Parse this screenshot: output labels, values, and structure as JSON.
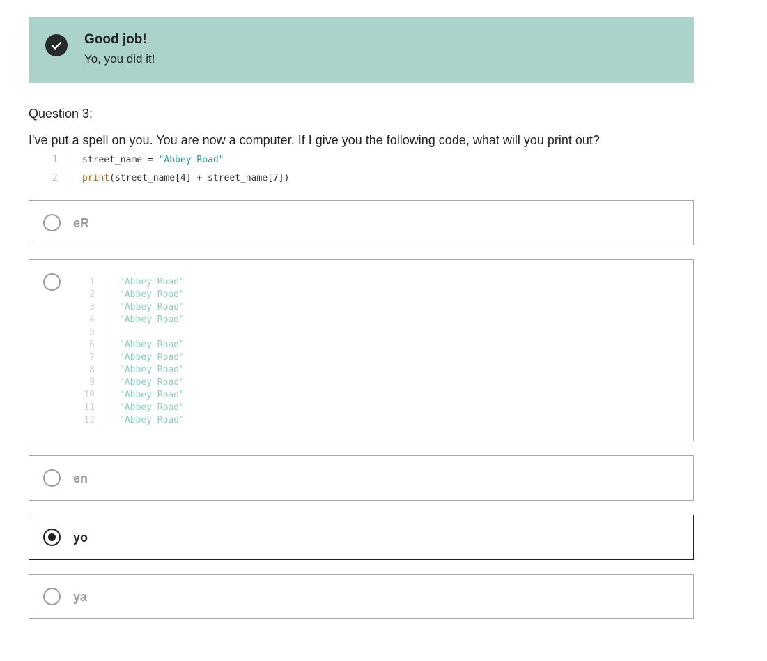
{
  "banner": {
    "title": "Good job!",
    "message": "Yo, you did it!",
    "icon": "check-icon",
    "bg_color": "#acd3cb"
  },
  "question": {
    "number_label": "Question 3:",
    "text": "I've put a spell on you. You are now a computer. If I give you the following code, what will you print out?",
    "code": {
      "lines": [
        {
          "num": "1",
          "var": "street_name",
          "op": " = ",
          "str": "\"Abbey Road\""
        },
        {
          "num": "2",
          "fn": "print",
          "rest": "(street_name[4] + street_name[7])"
        }
      ]
    }
  },
  "options": [
    {
      "label": "eR",
      "selected": false
    },
    {
      "label": "",
      "selected": false,
      "code_lines": [
        {
          "num": "1",
          "text": "\"Abbey Road\""
        },
        {
          "num": "2",
          "text": "\"Abbey Road\""
        },
        {
          "num": "3",
          "text": "\"Abbey Road\""
        },
        {
          "num": "4",
          "text": "\"Abbey Road\""
        },
        {
          "num": "5",
          "text": ""
        },
        {
          "num": "6",
          "text": "\"Abbey Road\""
        },
        {
          "num": "7",
          "text": "\"Abbey Road\""
        },
        {
          "num": "8",
          "text": "\"Abbey Road\""
        },
        {
          "num": "9",
          "text": "\"Abbey Road\""
        },
        {
          "num": "10",
          "text": "\"Abbey Road\""
        },
        {
          "num": "11",
          "text": "\"Abbey Road\""
        },
        {
          "num": "12",
          "text": "\"Abbey Road\""
        }
      ]
    },
    {
      "label": "en",
      "selected": false
    },
    {
      "label": "yo",
      "selected": true
    },
    {
      "label": "ya",
      "selected": false
    }
  ]
}
